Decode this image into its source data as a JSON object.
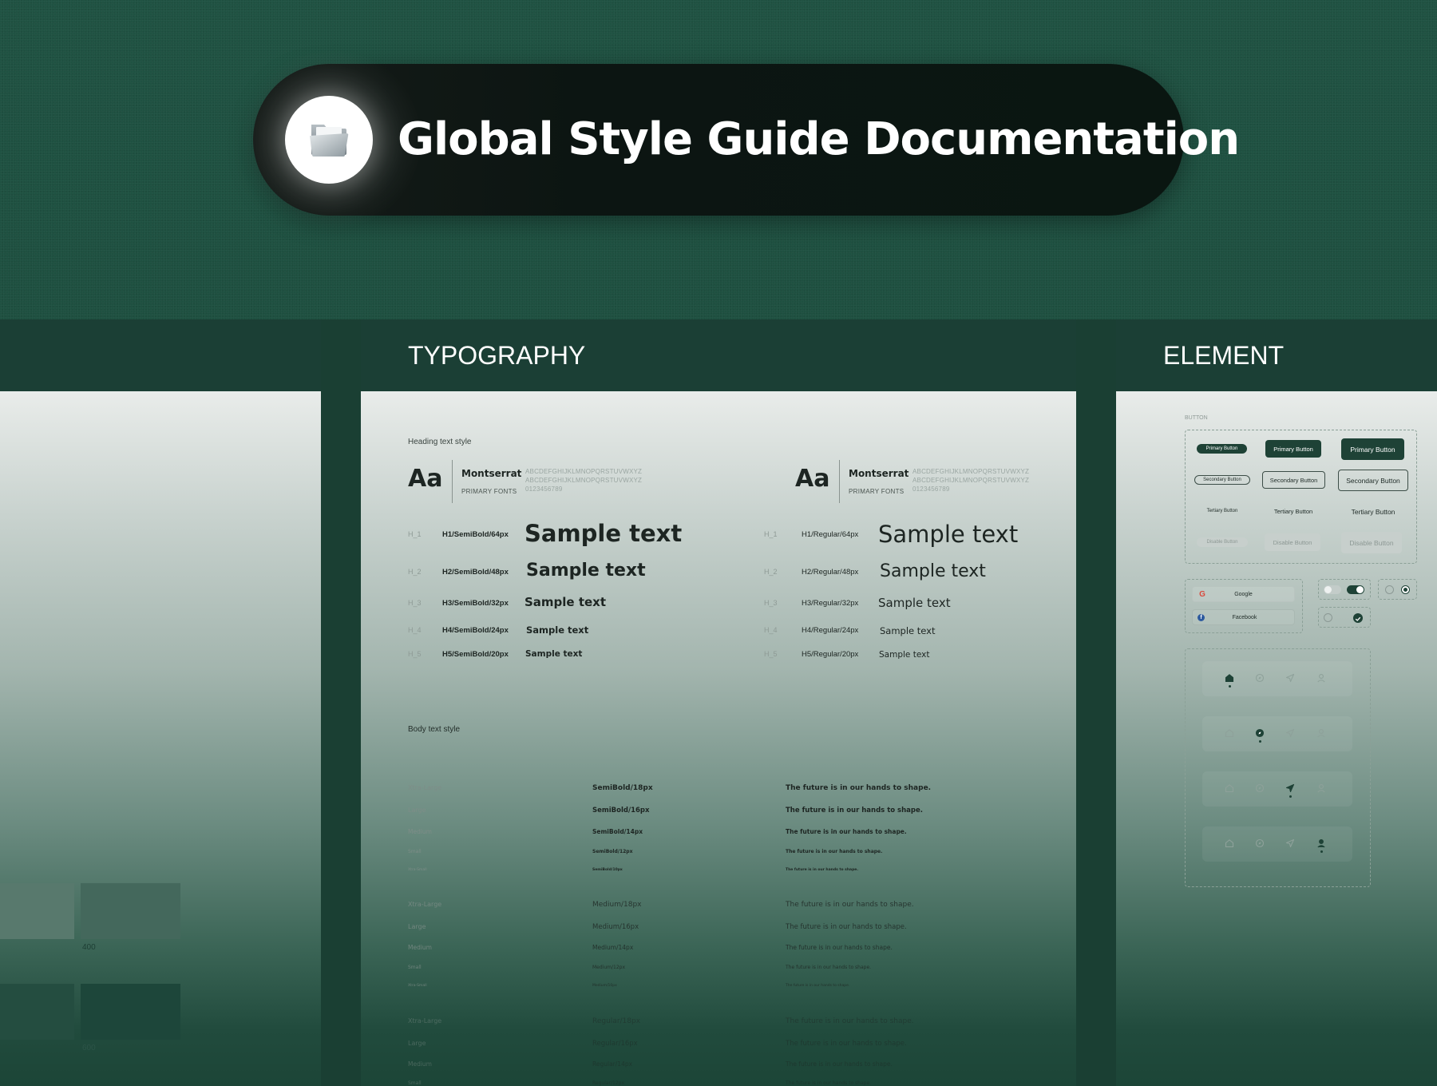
{
  "banner": {
    "title": "Global Style Guide Documentation",
    "icon": "folder-icon"
  },
  "left_panel": {
    "swatch_labels": [
      "400",
      "600"
    ]
  },
  "typography": {
    "header": "TYPOGRAPHY",
    "heading_section_label": "Heading text style",
    "font_cards": [
      {
        "aa": "Aa",
        "font": "Montserrat",
        "role": "PRIMARY FONTS",
        "upper": "ABCDEFGHIJKLMNOPQRSTUVWXYZ",
        "lower": "ABCDEFGHIJKLMNOPQRSTUVWXYZ",
        "digits": "0123456789"
      },
      {
        "aa": "Aa",
        "font": "Montserrat",
        "role": "PRIMARY FONTS",
        "upper": "ABCDEFGHIJKLMNOPQRSTUVWXYZ",
        "lower": "ABCDEFGHIJKLMNOPQRSTUVWXYZ",
        "digits": "0123456789"
      }
    ],
    "headings_semibold": [
      {
        "code": "H_1",
        "spec": "H1/SemiBold/64px",
        "sample": "Sample text"
      },
      {
        "code": "H_2",
        "spec": "H2/SemiBold/48px",
        "sample": "Sample text"
      },
      {
        "code": "H_3",
        "spec": "H3/SemiBold/32px",
        "sample": "Sample text"
      },
      {
        "code": "H_4",
        "spec": "H4/SemiBold/24px",
        "sample": "Sample text"
      },
      {
        "code": "H_5",
        "spec": "H5/SemiBold/20px",
        "sample": "Sample text"
      }
    ],
    "headings_regular": [
      {
        "code": "H_1",
        "spec": "H1/Regular/64px",
        "sample": "Sample text"
      },
      {
        "code": "H_2",
        "spec": "H2/Regular/48px",
        "sample": "Sample text"
      },
      {
        "code": "H_3",
        "spec": "H3/Regular/32px",
        "sample": "Sample text"
      },
      {
        "code": "H_4",
        "spec": "H4/Regular/24px",
        "sample": "Sample text"
      },
      {
        "code": "H_5",
        "spec": "H5/Regular/20px",
        "sample": "Sample text"
      }
    ],
    "body_section_label": "Body text style",
    "body_rows": [
      {
        "size": "Xtra-Large",
        "spec": "SemiBold/18px",
        "sample": "The future is in our hands to shape."
      },
      {
        "size": "Large",
        "spec": "SemiBold/16px",
        "sample": "The future is in our hands to shape."
      },
      {
        "size": "Medium",
        "spec": "SemiBold/14px",
        "sample": "The future is in our hands to shape."
      },
      {
        "size": "Small",
        "spec": "SemiBold/12px",
        "sample": "The future is in our hands to shape."
      },
      {
        "size": "Xtra-Small",
        "spec": "SemiBold/10px",
        "sample": "The future is in our hands to shape."
      },
      {
        "size": "Xtra-Large",
        "spec": "Medium/18px",
        "sample": "The future is in our hands to shape."
      },
      {
        "size": "Large",
        "spec": "Medium/16px",
        "sample": "The future is in our hands to shape."
      },
      {
        "size": "Medium",
        "spec": "Medium/14px",
        "sample": "The future is in our hands to shape."
      },
      {
        "size": "Small",
        "spec": "Medium/12px",
        "sample": "The future is in our hands to shape."
      },
      {
        "size": "Xtra-Small",
        "spec": "Medium/10px",
        "sample": "The future is in our hands to shape."
      },
      {
        "size": "Xtra-Large",
        "spec": "Regular/18px",
        "sample": "The future is in our hands to shape."
      },
      {
        "size": "Large",
        "spec": "Regular/16px",
        "sample": "The future is in our hands to shape."
      },
      {
        "size": "Medium",
        "spec": "Regular/14px",
        "sample": "The future is in our hands to shape."
      },
      {
        "size": "Small",
        "spec": "Regular/12px",
        "sample": "The future is in our hands to shape."
      }
    ]
  },
  "element": {
    "header": "ELEMENT",
    "button_section_label": "BUTTON",
    "buttons": {
      "primary": "Primary Button",
      "secondary": "Secondary Button",
      "tertiary": "Tertiary Button",
      "disabled": "Disable Button"
    },
    "social": {
      "google": "Google",
      "facebook": "Facebook"
    },
    "nav_icons": [
      "home-icon",
      "compass-icon",
      "send-icon",
      "user-icon"
    ]
  },
  "colors": {
    "background": "#1d4d3e",
    "panel_header": "#1b3f35",
    "pill": "#0c1512",
    "primary_button": "#1e4236"
  }
}
